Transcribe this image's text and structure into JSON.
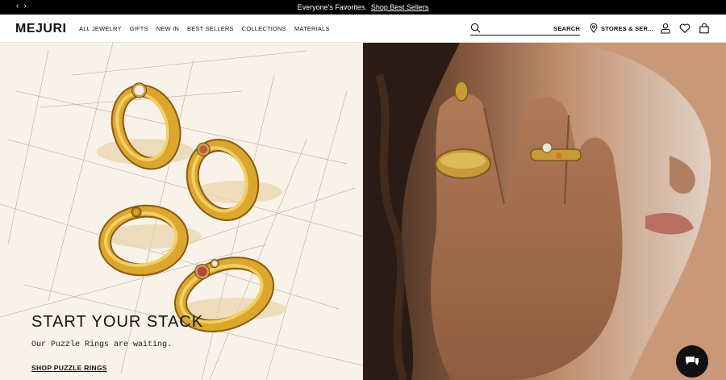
{
  "announcement": {
    "message": "Everyone's Favorites.",
    "link": "Shop Best Sellers",
    "prev_arrow": "‹",
    "next_arrow": "›"
  },
  "header": {
    "logo": "MEJURI",
    "nav": [
      "ALL JEWELRY",
      "GIFTS",
      "NEW IN",
      "BEST SELLERS",
      "COLLECTIONS",
      "MATERIALS"
    ],
    "search": {
      "placeholder": "",
      "button": "SEARCH"
    },
    "stores": "STORES & SER..."
  },
  "hero": {
    "headline": "START YOUR STACK",
    "subline": "Our Puzzle Rings are waiting.",
    "cta": "SHOP PUZZLE RINGS"
  },
  "colors": {
    "announce_bg": "#000000",
    "left_panel_bg": "#f8f2e8",
    "gold": "#d8a431",
    "chat_bg": "#111111"
  }
}
